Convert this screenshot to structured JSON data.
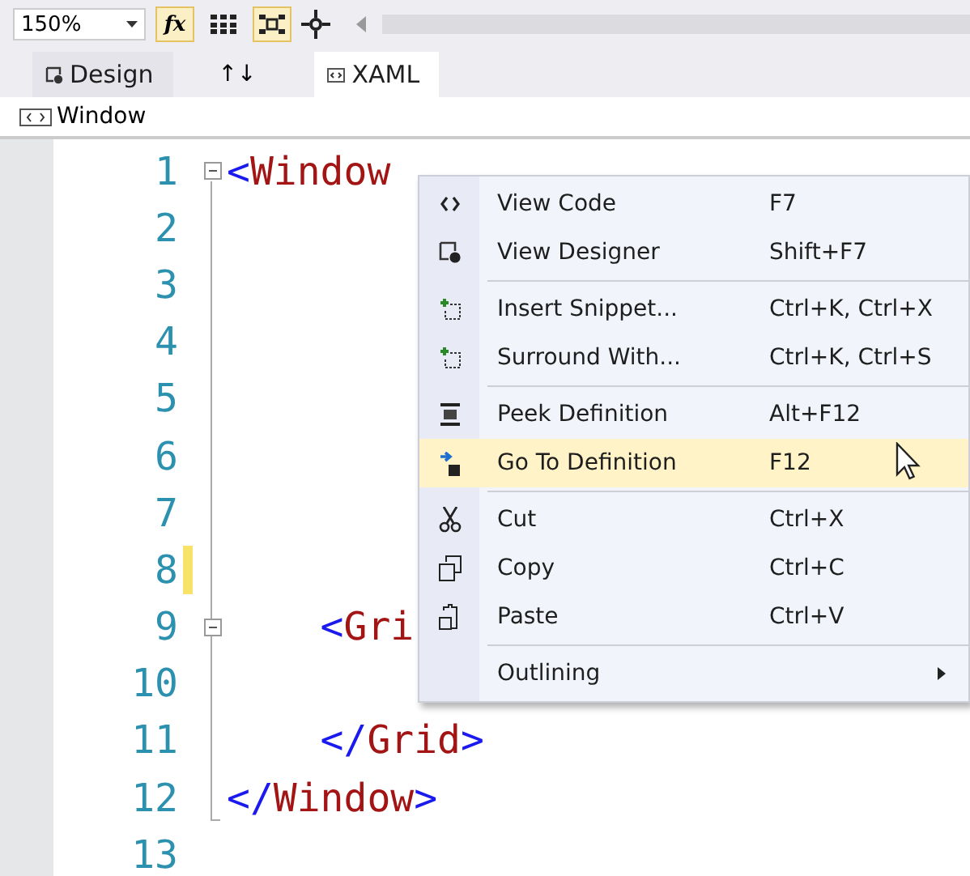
{
  "toolbar": {
    "zoom": "150%",
    "buttons": [
      {
        "label": "fx",
        "selected": true
      },
      {
        "selected": false
      },
      {
        "selected": true
      }
    ]
  },
  "view_tabs": [
    {
      "label": "Design",
      "selected": false
    },
    {
      "label": "XAML",
      "selected": true
    }
  ],
  "swap_label": "↑↓",
  "breadcrumb": "Window",
  "code_lines": [
    {
      "number": "1",
      "collapsible": true,
      "changed": false,
      "tokens": [
        {
          "kind": "punct",
          "text": "<"
        },
        {
          "kind": "tag",
          "text": "Window"
        }
      ]
    },
    {
      "number": "2",
      "collapsible": false,
      "changed": false
    },
    {
      "number": "3",
      "collapsible": false,
      "changed": false
    },
    {
      "number": "4",
      "collapsible": false,
      "changed": false
    },
    {
      "number": "5",
      "collapsible": false,
      "changed": false
    },
    {
      "number": "6",
      "collapsible": false,
      "changed": false
    },
    {
      "number": "7",
      "collapsible": false,
      "changed": false
    },
    {
      "number": "8",
      "collapsible": false,
      "changed": true
    },
    {
      "number": "9",
      "collapsible": true,
      "changed": false,
      "tokens": [
        {
          "kind": "punct",
          "text": "    <"
        },
        {
          "kind": "tag",
          "text": "Gri"
        }
      ]
    },
    {
      "number": "10",
      "collapsible": false,
      "changed": false
    },
    {
      "number": "11",
      "collapsible": false,
      "changed": false,
      "tokens": [
        {
          "kind": "punct",
          "text": "    </"
        },
        {
          "kind": "tag",
          "text": "Grid"
        },
        {
          "kind": "punct",
          "text": ">"
        }
      ]
    },
    {
      "number": "12",
      "collapsible": false,
      "changed": false,
      "tokens": [
        {
          "kind": "punct",
          "text": "</"
        },
        {
          "kind": "tag",
          "text": "Window"
        },
        {
          "kind": "punct",
          "text": ">"
        }
      ]
    },
    {
      "number": "13",
      "collapsible": false,
      "changed": false
    }
  ],
  "context_menu": [
    {
      "kind": "item",
      "label": "View Code",
      "shortcut": "F7",
      "selected": false,
      "submenu": false
    },
    {
      "kind": "item",
      "label": "View Designer",
      "shortcut": "Shift+F7",
      "selected": false,
      "submenu": false
    },
    {
      "kind": "separator"
    },
    {
      "kind": "item",
      "label": "Insert Snippet...",
      "shortcut": "Ctrl+K, Ctrl+X",
      "selected": false,
      "submenu": false
    },
    {
      "kind": "item",
      "label": "Surround With...",
      "shortcut": "Ctrl+K, Ctrl+S",
      "selected": false,
      "submenu": false
    },
    {
      "kind": "separator"
    },
    {
      "kind": "item",
      "label": "Peek Definition",
      "shortcut": "Alt+F12",
      "selected": false,
      "submenu": false
    },
    {
      "kind": "item",
      "label": "Go To Definition",
      "shortcut": "F12",
      "selected": true,
      "submenu": false
    },
    {
      "kind": "separator"
    },
    {
      "kind": "item",
      "label": "Cut",
      "shortcut": "Ctrl+X",
      "selected": false,
      "submenu": false
    },
    {
      "kind": "item",
      "label": "Copy",
      "shortcut": "Ctrl+C",
      "selected": false,
      "submenu": false
    },
    {
      "kind": "item",
      "label": "Paste",
      "shortcut": "Ctrl+V",
      "selected": false,
      "submenu": false
    },
    {
      "kind": "separator"
    },
    {
      "kind": "item",
      "label": "Outlining",
      "selected": false,
      "submenu": true
    }
  ]
}
